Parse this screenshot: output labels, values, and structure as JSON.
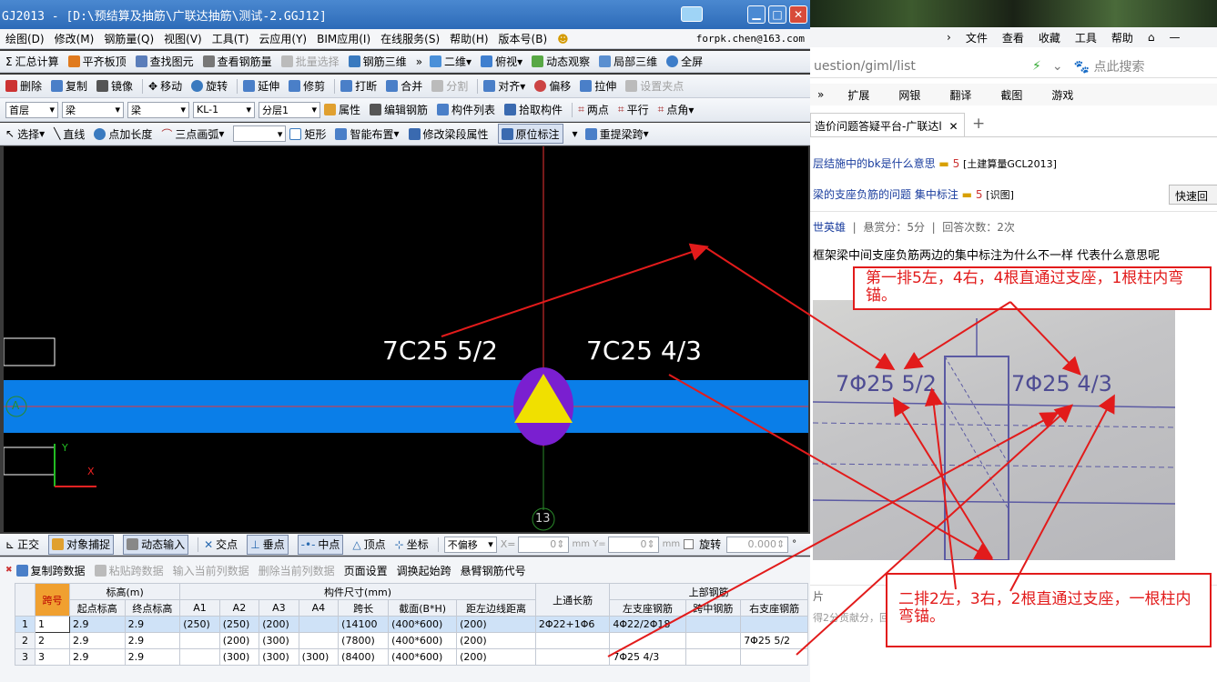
{
  "window": {
    "title": "GJ2013 - [D:\\预结算及抽筋\\广联达抽筋\\测试-2.GGJ12]"
  },
  "menu": [
    "绘图(D)",
    "修改(M)",
    "钢筋量(Q)",
    "视图(V)",
    "工具(T)",
    "云应用(Y)",
    "BIM应用(I)",
    "在线服务(S)",
    "帮助(H)",
    "版本号(B)"
  ],
  "account": "forpk.chen@163.com",
  "toolbar1": [
    "汇总计算",
    "平齐板顶",
    "查找图元",
    "查看钢筋量",
    "批量选择",
    "钢筋三维",
    "二维",
    "俯视",
    "动态观察",
    "局部三维",
    "全屏"
  ],
  "toolbar2": [
    "删除",
    "复制",
    "镜像",
    "移动",
    "旋转",
    "延伸",
    "修剪",
    "打断",
    "合并",
    "分割",
    "对齐",
    "偏移",
    "拉伸",
    "设置夹点"
  ],
  "toolbar3": {
    "floor": "首层",
    "type1": "梁",
    "type2": "梁",
    "comp": "KL-1",
    "layer": "分层1",
    "items": [
      "属性",
      "编辑钢筋",
      "构件列表",
      "拾取构件",
      "两点",
      "平行",
      "点角"
    ]
  },
  "toolbar4": [
    "选择",
    "直线",
    "点加长度",
    "三点画弧",
    "矩形",
    "智能布置",
    "修改梁段属性",
    "原位标注",
    "重提梁跨"
  ],
  "canvas": {
    "label_left": "7C25 5/2",
    "label_right": "7C25 4/3",
    "axis_a": "A",
    "axis_13": "13",
    "y": "Y",
    "x": "X"
  },
  "statusbar": {
    "items": [
      "正交",
      "对象捕捉",
      "动态输入",
      "交点",
      "垂点",
      "中点",
      "顶点",
      "坐标"
    ],
    "offset": "不偏移",
    "x_label": "X=",
    "x_val": "0",
    "y_label": "mm Y=",
    "y_val": "0",
    "unit": "mm",
    "rotate": "旋转",
    "rotate_val": "0.000"
  },
  "gridbar": [
    "复制跨数据",
    "粘贴跨数据",
    "输入当前列数据",
    "删除当前列数据",
    "页面设置",
    "调换起始跨",
    "悬臂钢筋代号"
  ],
  "table": {
    "groups": {
      "span": "跨号",
      "elev": "标高(m)",
      "size": "构件尺寸(mm)",
      "through": "上通长筋",
      "top": "上部钢筋"
    },
    "headers": [
      "起点标高",
      "终点标高",
      "A1",
      "A2",
      "A3",
      "A4",
      "跨长",
      "截面(B*H)",
      "距左边线距离",
      "左支座钢筋",
      "跨中钢筋",
      "右支座钢筋"
    ],
    "rows": [
      [
        "1",
        "1",
        "2.9",
        "2.9",
        "(250)",
        "(250)",
        "(200)",
        "",
        "(14100",
        "(400*600)",
        "(200)",
        "2Φ22+1Φ6",
        "4Φ22/2Φ18",
        "",
        ""
      ],
      [
        "2",
        "2",
        "2.9",
        "2.9",
        "",
        "(200)",
        "(300)",
        "",
        "(7800)",
        "(400*600)",
        "(200)",
        "",
        "",
        "",
        "7Φ25 5/2"
      ],
      [
        "3",
        "3",
        "2.9",
        "2.9",
        "",
        "(300)",
        "(300)",
        "(300)",
        "(8400)",
        "(400*600)",
        "(200)",
        "",
        "7Φ25 4/3",
        "",
        ""
      ]
    ]
  },
  "browser": {
    "menu": [
      "文件",
      "查看",
      "收藏",
      "工具",
      "帮助"
    ],
    "url": "uestion/giml/list",
    "search": "点此搜索",
    "bar": [
      "扩展",
      "网银",
      "翻译",
      "截图",
      "游戏"
    ],
    "tab": "造价问题答疑平台-广联达l",
    "q1": "层结施中的bk是什么意思",
    "q1_score": "5",
    "q1_tag": "[土建算量GCL2013]",
    "q2": "梁的支座负筋的问题 集中标注",
    "q2_score": "5",
    "q2_tag": "[识图]",
    "quick": "快速回",
    "meta": [
      "世英雄",
      "悬赏分：5分",
      "回答次数：2次"
    ],
    "question": "框架梁中间支座负筋两边的集中标注为什么不一样 代表什么意思呢",
    "photo_left": "7Φ25 5/2",
    "photo_right": "7Φ25 4/3",
    "img_label": "片",
    "footer": "得2分贡献分，回答被采纳额外奖励20贡献分及提问者悬赏分..."
  },
  "notes": {
    "top": "第一排5左，4右，4根直通过支座，1根柱内弯锚。",
    "bottom": "二排2左，3右，2根直通过支座，一根柱内弯锚。"
  }
}
